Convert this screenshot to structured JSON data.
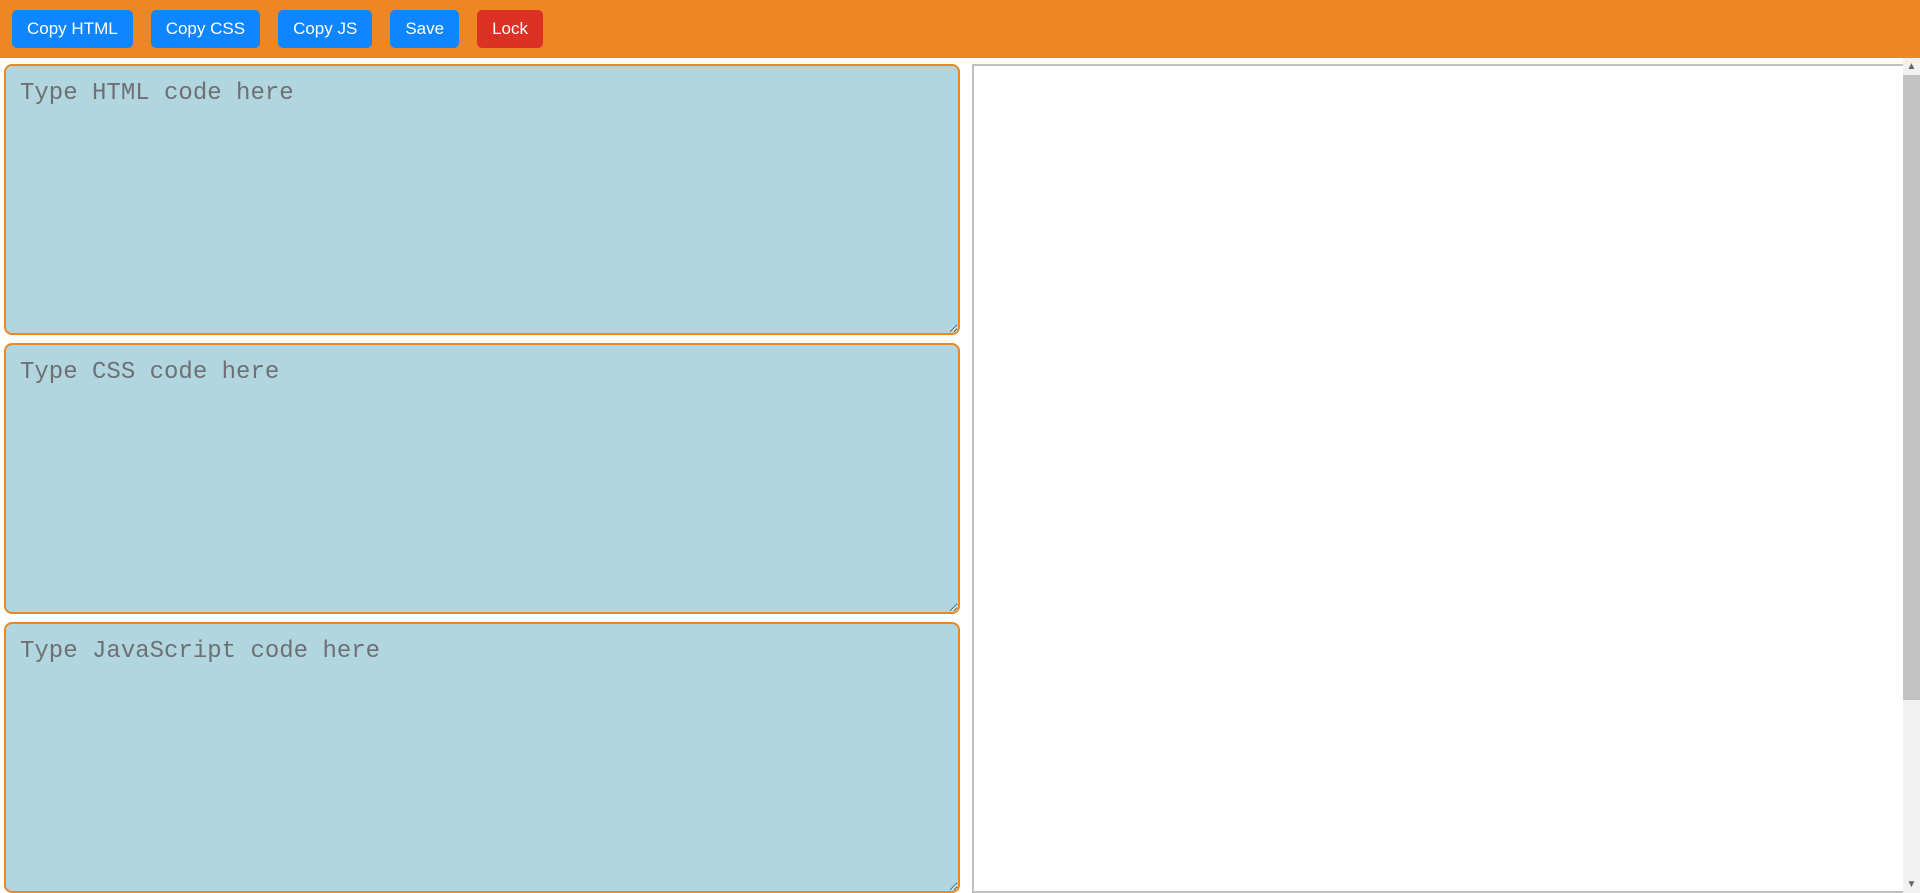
{
  "toolbar": {
    "copy_html_label": "Copy HTML",
    "copy_css_label": "Copy CSS",
    "copy_js_label": "Copy JS",
    "save_label": "Save",
    "lock_label": "Lock"
  },
  "editors": {
    "html": {
      "placeholder": "Type HTML code here",
      "value": ""
    },
    "css": {
      "placeholder": "Type CSS code here",
      "value": ""
    },
    "js": {
      "placeholder": "Type JavaScript code here",
      "value": ""
    }
  }
}
